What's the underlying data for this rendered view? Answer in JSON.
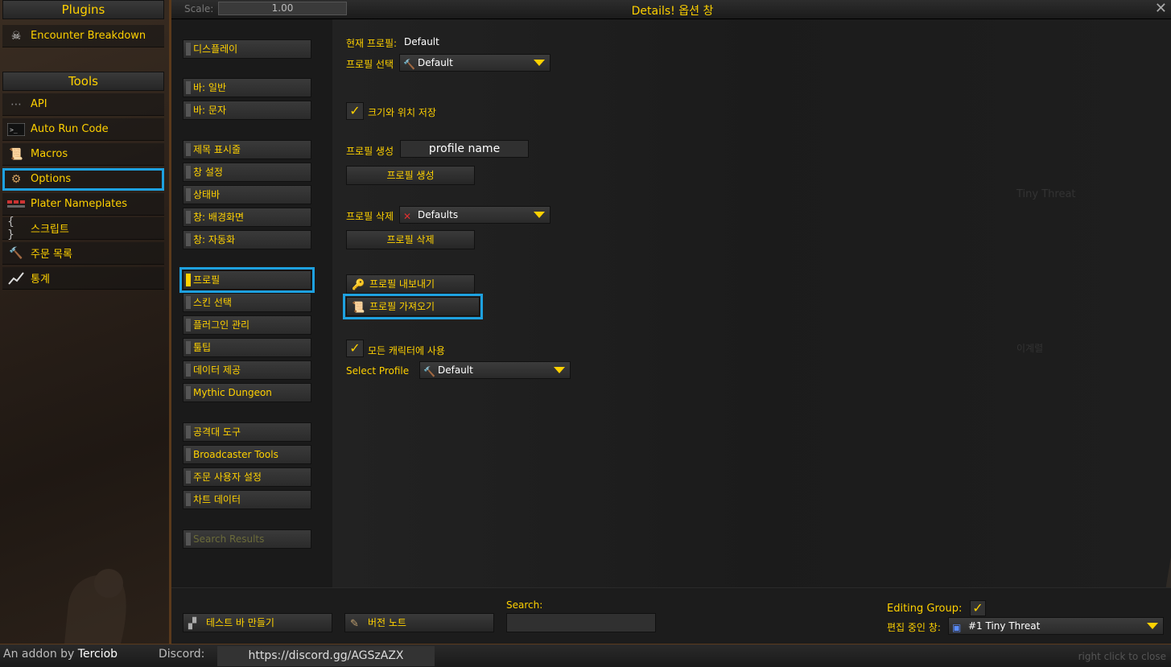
{
  "sidebar": {
    "plugins_header": "Plugins",
    "plugins": [
      {
        "label": "Encounter Breakdown",
        "icon": "skull-icon"
      }
    ],
    "tools_header": "Tools",
    "tools": [
      {
        "label": "API",
        "icon": "dots-icon"
      },
      {
        "label": "Auto Run Code",
        "icon": "console-icon"
      },
      {
        "label": "Macros",
        "icon": "scroll-icon"
      },
      {
        "label": "Options",
        "icon": "gear-icon"
      },
      {
        "label": "Plater Nameplates",
        "icon": "nameplates-icon"
      },
      {
        "label": "스크립트",
        "icon": "braces-icon"
      },
      {
        "label": "주문 목록",
        "icon": "hammer-icon"
      },
      {
        "label": "통계",
        "icon": "chart-icon"
      }
    ],
    "active_tool": "Options"
  },
  "window": {
    "title": "Details! 옵션 창",
    "scale_label": "Scale:",
    "scale_value": "1.00",
    "close": "✕"
  },
  "menu": {
    "items": [
      "디스플레이",
      "바: 일반",
      "바: 문자",
      "제목 표시줄",
      "창 설정",
      "상태바",
      "창: 배경화면",
      "창: 자동화",
      "프로필",
      "스킨 선택",
      "플러그인 관리",
      "툴팁",
      "데이터 제공",
      "Mythic Dungeon",
      "공격대 도구",
      "Broadcaster Tools",
      "주문 사용자 설정",
      "차트 데이터",
      "Search Results"
    ],
    "active": "프로필"
  },
  "profile": {
    "current_label": "현재 프로필:",
    "current_value": "Default",
    "select_label": "프로필 선택",
    "select_value": "Default",
    "save_size_label": "크기와 위치 저장",
    "create_label": "프로필 생성",
    "create_input": "profile name",
    "create_button": "프로필 생성",
    "delete_label": "프로필 삭제",
    "delete_value": "Defaults",
    "delete_button": "프로필 삭제",
    "export_button": "프로필 내보내기",
    "import_button": "프로필 가져오기",
    "use_all_label": "모든 캐릭터에 사용",
    "select_profile_label": "Select Profile",
    "select_profile_value": "Default"
  },
  "background_faint": {
    "text1": "Tiny Threat",
    "text2": "이계렬"
  },
  "bottom": {
    "test_bars_button": "테스트 바 만들기",
    "version_notes_button": "버전 노트",
    "search_label": "Search:",
    "editing_group_label": "Editing Group:",
    "editing_window_label": "편집 중인 창:",
    "editing_window_value": "#1 Tiny Threat"
  },
  "footer": {
    "addon_by": "An addon by",
    "author": "Terciob",
    "discord_label": "Discord:",
    "discord_url": "https://discord.gg/AGSzAZX",
    "right_click_hint": "right click to close"
  },
  "colors": {
    "accent_gold": "#ffd100",
    "highlight_blue": "#1ea1e0"
  }
}
